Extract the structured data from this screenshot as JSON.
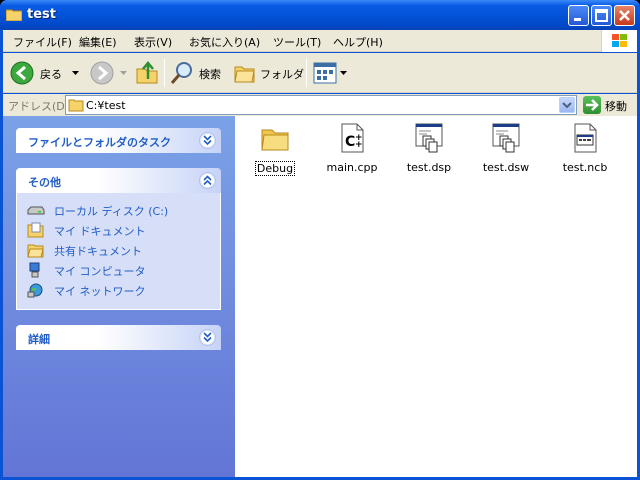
{
  "window": {
    "title": "test"
  },
  "menu": [
    "ファイル(F)",
    "編集(E)",
    "表示(V)",
    "お気に入り(A)",
    "ツール(T)",
    "ヘルプ(H)"
  ],
  "toolbar": {
    "back": "戻る",
    "search": "検索",
    "folders": "フォルダ"
  },
  "address": {
    "label": "アドレス(D)",
    "path": "C:¥test",
    "go": "移動"
  },
  "sidebar": {
    "tasks_title": "ファイルとフォルダのタスク",
    "other_title": "その他",
    "other_items": [
      {
        "label": "ローカル ディスク (C:)",
        "icon": "drive-icon"
      },
      {
        "label": "マイ ドキュメント",
        "icon": "my-documents-icon"
      },
      {
        "label": "共有ドキュメント",
        "icon": "shared-documents-icon"
      },
      {
        "label": "マイ コンピュータ",
        "icon": "my-computer-icon"
      },
      {
        "label": "マイ ネットワーク",
        "icon": "my-network-icon"
      }
    ],
    "details_title": "詳細"
  },
  "files": [
    {
      "name": "Debug",
      "icon": "folder-icon"
    },
    {
      "name": "main.cpp",
      "icon": "cpp-file-icon"
    },
    {
      "name": "test.dsp",
      "icon": "dsp-file-icon"
    },
    {
      "name": "test.dsw",
      "icon": "dsw-file-icon"
    },
    {
      "name": "test.ncb",
      "icon": "ncb-file-icon"
    }
  ],
  "colors": {
    "title_blue": "#0A5BE4",
    "task_text": "#215DC6",
    "sidebar_top": "#7BA2E7",
    "sidebar_bottom": "#6375D6"
  }
}
